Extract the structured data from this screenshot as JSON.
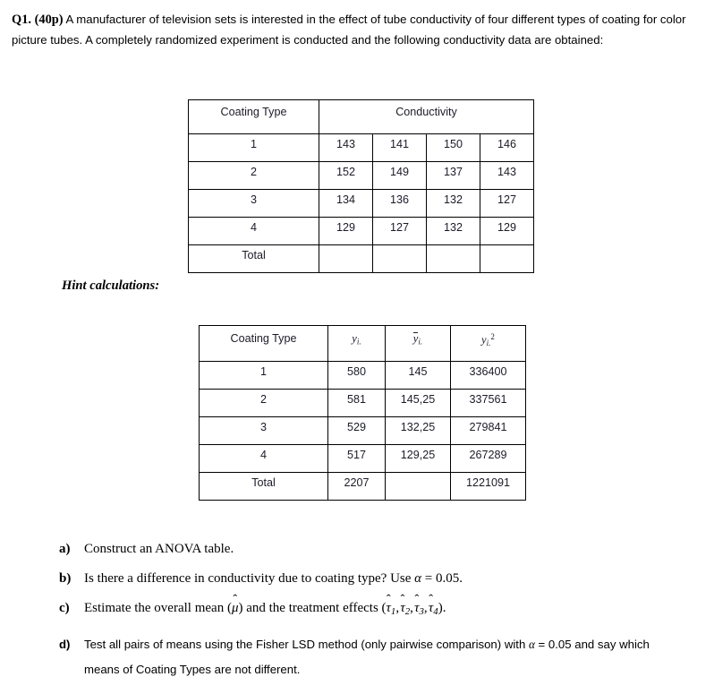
{
  "intro": {
    "question_label": "Q1. (40p)",
    "body": " A manufacturer of television sets is interested in the effect of tube conductivity of four different types of coating for color picture tubes. A completely randomized experiment is conducted and the following conductivity data are obtained:"
  },
  "hint_label": "Hint calculations:",
  "table_conductivity": {
    "headers": {
      "coating_type": "Coating Type",
      "conductivity": "Conductivity"
    },
    "rows": [
      {
        "type": "1",
        "values": [
          "143",
          "141",
          "150",
          "146"
        ]
      },
      {
        "type": "2",
        "values": [
          "152",
          "149",
          "137",
          "143"
        ]
      },
      {
        "type": "3",
        "values": [
          "134",
          "136",
          "132",
          "127"
        ]
      },
      {
        "type": "4",
        "values": [
          "129",
          "127",
          "132",
          "129"
        ]
      },
      {
        "type": "Total",
        "values": [
          "",
          "",
          "",
          ""
        ]
      }
    ]
  },
  "table_hint": {
    "headers": {
      "coating_type": "Coating Type",
      "yi_var": "y",
      "yi_sub": "i.",
      "ybar_var": "y",
      "ybar_sub": "i.",
      "ysq_var": "y",
      "ysq_sub": "i.",
      "ysq_sup": "2"
    },
    "rows": [
      {
        "type": "1",
        "yi": "580",
        "ybar": "145",
        "ysq": "336400"
      },
      {
        "type": "2",
        "yi": "581",
        "ybar": "145,25",
        "ysq": "337561"
      },
      {
        "type": "3",
        "yi": "529",
        "ybar": "132,25",
        "ysq": "279841"
      },
      {
        "type": "4",
        "yi": "517",
        "ybar": "129,25",
        "ysq": "267289"
      },
      {
        "type": "Total",
        "yi": "2207",
        "ybar": "",
        "ysq": "1221091"
      }
    ]
  },
  "questions": {
    "a": {
      "marker": "a)",
      "text": "Construct an ANOVA table."
    },
    "b": {
      "marker": "b)",
      "text_before": "Is there a difference in conductivity due to coating type? Use ",
      "alpha": "α",
      "equals_value": " = 0.05."
    },
    "c": {
      "marker": "c)",
      "text_before": "Estimate the overall mean (",
      "mu": "μ",
      "text_mid": ") and the treatment effects (",
      "tau": "τ",
      "tau_subs": [
        "1",
        "2",
        "3",
        "4"
      ],
      "text_after": ")."
    },
    "d": {
      "marker": "d)",
      "text_before": "Test all pairs of means using the Fisher LSD method (only pairwise comparison) with ",
      "alpha": "α",
      "equals_value": " = 0.05 and say which",
      "text_cont": "means of Coating Types are not different."
    }
  }
}
